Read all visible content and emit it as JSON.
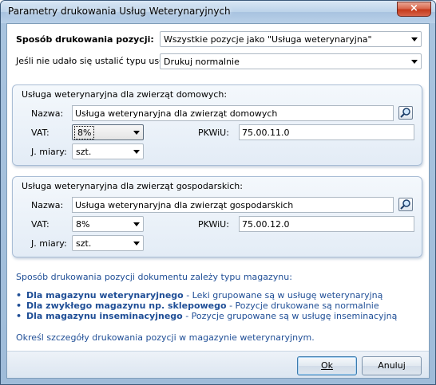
{
  "window": {
    "title": "Parametry drukowania Usług Weterynaryjnych",
    "ghost_title": "",
    "close_label": "×"
  },
  "print_mode": {
    "label": "Sposób drukowania pozycji:",
    "value": "Wszystkie pozycje jako \"Usługa weterynaryjna\""
  },
  "unknown_type": {
    "label": "Jeśli nie udało się ustalić typu usługi:",
    "value": "Drukuj normalnie"
  },
  "domestic": {
    "title": "Usługa weterynaryjna dla zwierząt domowych:",
    "name_label": "Nazwa:",
    "name_value": "Usługa weterynaryjna dla zwierząt domowych",
    "vat_label": "VAT:",
    "vat_value": "8%",
    "pkwiu_label": "PKWiU:",
    "pkwiu_value": "75.00.11.0",
    "unit_label": "J. miary:",
    "unit_value": "szt."
  },
  "farm": {
    "title": "Usługa weterynaryjna dla zwierząt gospodarskich:",
    "name_label": "Nazwa:",
    "name_value": "Usługa weterynaryjna dla zwierząt gospodarskich",
    "vat_label": "VAT:",
    "vat_value": "8%",
    "pkwiu_label": "PKWiU:",
    "pkwiu_value": "75.00.12.0",
    "unit_label": "J. miary:",
    "unit_value": "szt."
  },
  "info": {
    "intro": "Sposób drukowania pozycji dokumentu zależy typu magazynu:",
    "bullets": [
      {
        "bold": "Dla magazynu weterynaryjnego",
        "rest": " - Leki grupowane są w usługę weterynaryjną"
      },
      {
        "bold": "Dla zwykłego magazynu np. sklepowego",
        "rest": " - Pozycje drukowane są normalnie"
      },
      {
        "bold": "Dla magazynu inseminacyjnego",
        "rest": " - Pozycje grupowane są w usługę inseminacyjną"
      }
    ],
    "details": "Określ szczegóły drukowania pozycji w magazynie weterynaryjnym."
  },
  "buttons": {
    "ok_label": "Ok",
    "cancel_label": "Anuluj"
  }
}
